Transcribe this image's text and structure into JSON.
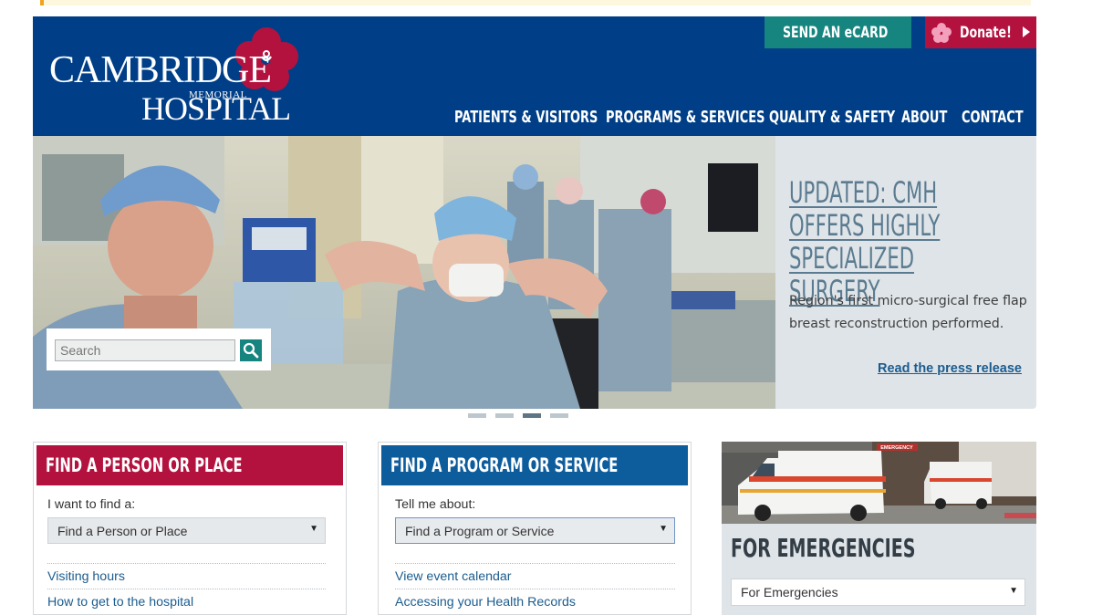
{
  "header": {
    "logo": {
      "line1": "CAMBRIDGE",
      "line2": "MEMORIAL",
      "line3": "HOSPITAL"
    },
    "ecard_label": "SEND AN eCARD",
    "donate_label": "Donate!",
    "nav": [
      "PATIENTS & VISITORS",
      "PROGRAMS & SERVICES",
      "QUALITY & SAFETY",
      "ABOUT",
      "CONTACT"
    ]
  },
  "hero": {
    "search_placeholder": "Search",
    "title": "UPDATED: CMH OFFERS HIGHLY SPECIALIZED SURGERY",
    "description": "Region's first micro-surgical free flap breast reconstruction performed.",
    "link": "Read the press release",
    "slide_count": 4,
    "active_slide": 3
  },
  "find_person": {
    "title": "FIND A PERSON OR PLACE",
    "label": "I want to find a:",
    "select_value": "Find a Person or Place",
    "links": [
      "Visiting hours",
      "How to get to the hospital"
    ]
  },
  "find_program": {
    "title": "FIND A PROGRAM OR SERVICE",
    "label": "Tell me about:",
    "select_value": "Find a Program or Service",
    "links": [
      "View event calendar",
      "Accessing your Health Records"
    ]
  },
  "emergencies": {
    "title": "FOR EMERGENCIES",
    "select_value": "For Emergencies",
    "sign": "EMERGENCY"
  },
  "colors": {
    "navy": "#003f87",
    "teal": "#16847f",
    "crimson": "#b3123f",
    "program_blue": "#0d5c9c",
    "panel_gray": "#dfe4e8",
    "link_blue": "#1b5c8f"
  }
}
